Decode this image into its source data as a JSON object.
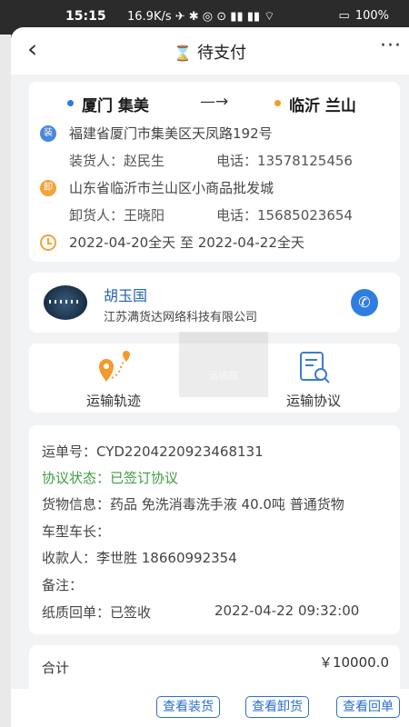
{
  "status_bar": {
    "time": "15:15",
    "speed": "16.9K/s",
    "battery": "100%"
  },
  "header": {
    "title": "待支付",
    "back_icon": "chevron-left-icon",
    "status_icon": "hourglass-icon",
    "more_icon": "more-icon"
  },
  "route": {
    "from": "厦门 集美",
    "arrow": "—→",
    "to": "临沂 兰山",
    "load_tag": "装",
    "unload_tag": "卸",
    "load_address": "福建省厦门市集美区天凤路192号",
    "loader": "装货人：赵民生",
    "loader_phone": "电话：13578125456",
    "unload_address": "山东省临沂市兰山区小商品批发城",
    "unloader": "卸货人：王晓阳",
    "unloader_phone": "电话：15685023654",
    "time_range": "2022-04-20全天 至 2022-04-22全天"
  },
  "driver": {
    "name": "胡玉国",
    "company": "江苏满货达网络科技有限公司"
  },
  "actions": {
    "track_label": "运输轨迹",
    "agreement_label": "运输协议"
  },
  "watermark": "运输联",
  "details": {
    "waybill": "运单号：CYD2204220923468131",
    "agreement_status": "协议状态：已签订协议",
    "goods": "货物信息：药品  免洗消毒洗手液  40.0吨  普通货物",
    "vehicle": "车型车长：",
    "payee": "收款人：李世胜  18660992354",
    "remark": "备注：",
    "receipt": "纸质回单：已签收",
    "receipt_time": "2022-04-22 09:32:00"
  },
  "total": {
    "label": "合计",
    "value": "￥10000.0"
  },
  "bottom_buttons": {
    "view_loading": "查看装货",
    "view_unloading": "查看卸货",
    "view_receipt": "查看回单"
  },
  "colors": {
    "accent_blue": "#2b6fd0",
    "status_green": "#3f9b3f",
    "orange": "#f2a33a"
  }
}
